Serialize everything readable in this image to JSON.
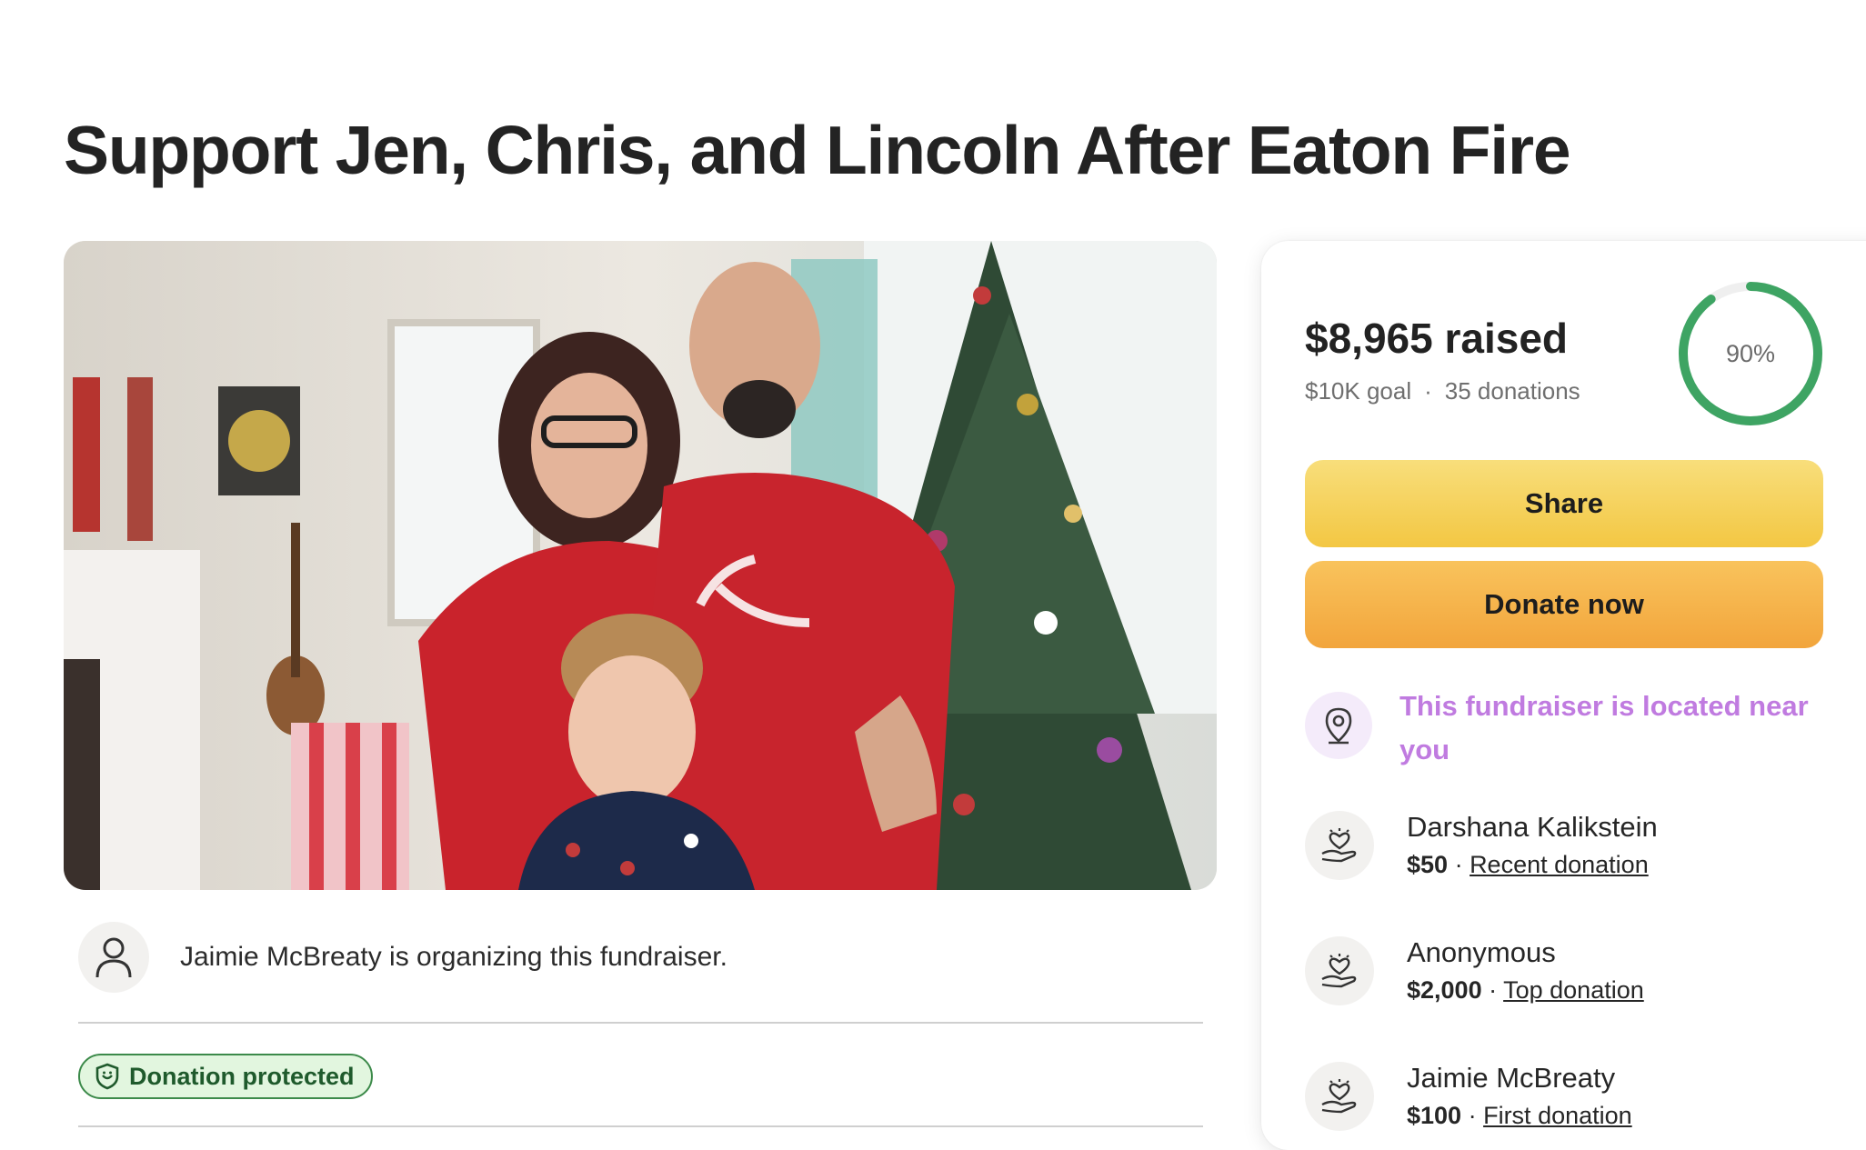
{
  "fundraiser": {
    "title": "Support Jen, Chris, and Lincoln After Eaton Fire"
  },
  "organizer": {
    "text": "Jaimie McBreaty is organizing this fundraiser."
  },
  "badge": {
    "label": "Donation protected"
  },
  "stats": {
    "raised": "$8,965 raised",
    "goal": "$10K goal",
    "donations": "35 donations",
    "percent_label": "90%",
    "progress_fraction": 0.9
  },
  "buttons": {
    "share": "Share",
    "donate": "Donate now"
  },
  "location_note": "This fundraiser is located near you",
  "donors": [
    {
      "name": "Darshana Kalikstein",
      "amount": "$50",
      "tag": "Recent donation"
    },
    {
      "name": "Anonymous",
      "amount": "$2,000",
      "tag": "Top donation"
    },
    {
      "name": "Jaimie McBreaty",
      "amount": "$100",
      "tag": "First donation"
    }
  ],
  "colors": {
    "progress": "#3ea463",
    "share_button": "#f3c743",
    "donate_button": "#f2a53c",
    "location_accent": "#c07be0",
    "badge_border": "#3c8a4a"
  },
  "icons": {
    "organizer": "user-icon",
    "badge": "shield-icon",
    "location": "map-pin-icon",
    "donor": "heart-hand-icon"
  }
}
